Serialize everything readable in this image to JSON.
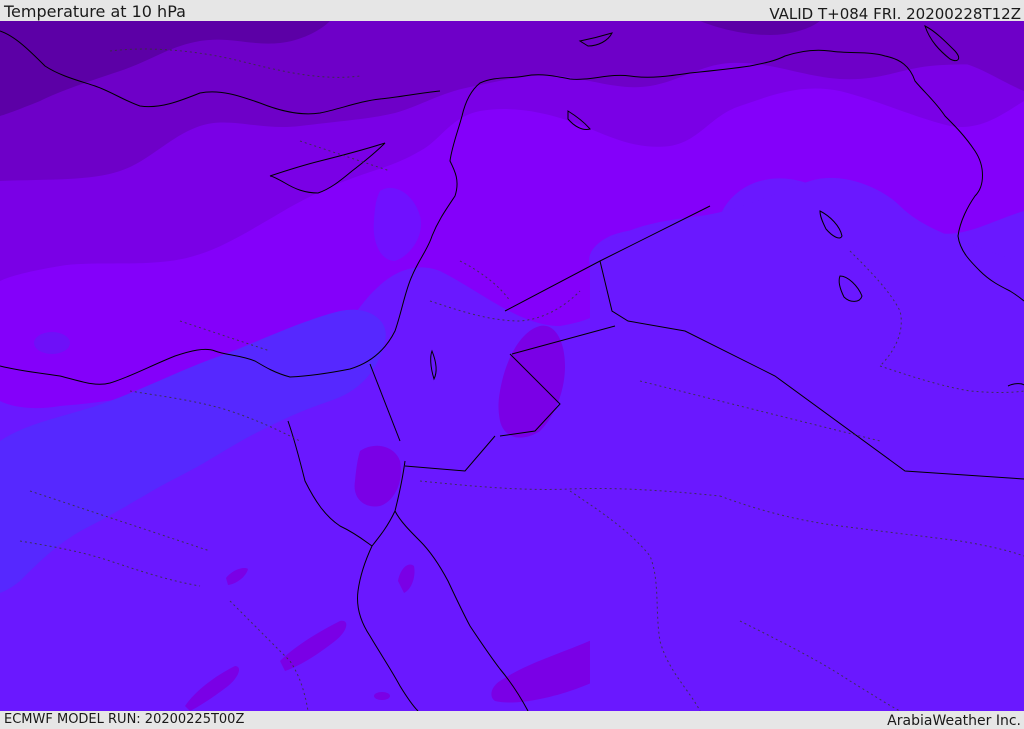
{
  "header": {
    "title": "Temperature at 10 hPa",
    "valid_time": "VALID T+084 FRI. 20200228T12Z"
  },
  "footer": {
    "model_run": "ECMWF MODEL RUN: 20200225T00Z",
    "credit": "ArabiaWeather Inc."
  },
  "colors": {
    "header_bg": "#e6e6e6",
    "coldest": "#5c00a6",
    "colder": "#6e00c8",
    "cold": "#7a00e6",
    "mid": "#8400fa",
    "warm": "#6e10f8",
    "warmer": "#6a18ff",
    "warmest": "#5628ff",
    "coast": "#000000"
  }
}
